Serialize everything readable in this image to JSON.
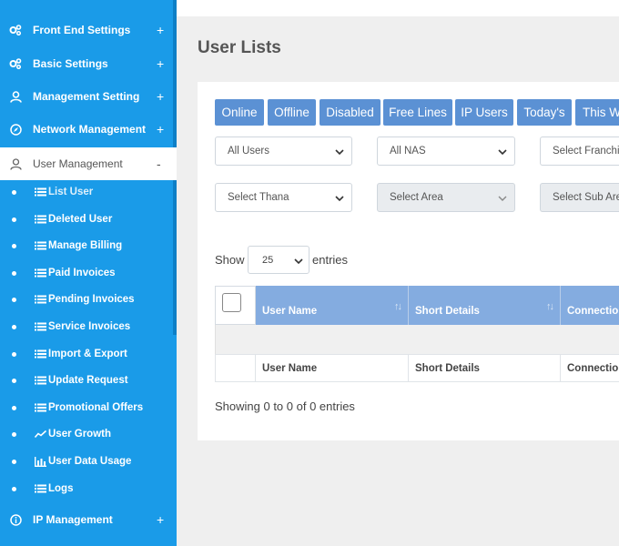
{
  "sidebar": {
    "menu": [
      {
        "label": "Front End Settings",
        "icon": "cogs-icon",
        "toggle": "+"
      },
      {
        "label": "Basic Settings",
        "icon": "cogs-icon",
        "toggle": "+"
      },
      {
        "label": "Management Setting",
        "icon": "user-icon",
        "toggle": "+"
      },
      {
        "label": "Network Management",
        "icon": "compass-icon",
        "toggle": "+"
      },
      {
        "label": "User Management",
        "icon": "user-icon",
        "toggle": "-"
      }
    ],
    "sub_items": [
      {
        "label": "List User",
        "icon": "list-icon"
      },
      {
        "label": "Deleted User",
        "icon": "list-icon"
      },
      {
        "label": "Manage Billing",
        "icon": "list-icon"
      },
      {
        "label": "Paid Invoices",
        "icon": "list-icon"
      },
      {
        "label": "Pending Invoices",
        "icon": "list-icon"
      },
      {
        "label": "Service Invoices",
        "icon": "list-icon"
      },
      {
        "label": "Import & Export",
        "icon": "list-icon"
      },
      {
        "label": "Update Request",
        "icon": "list-icon"
      },
      {
        "label": "Promotional Offers",
        "icon": "list-icon"
      },
      {
        "label": "User Growth",
        "icon": "line-chart-icon"
      },
      {
        "label": "User Data Usage",
        "icon": "bar-chart-icon"
      },
      {
        "label": "Logs",
        "icon": "list-icon"
      }
    ],
    "bottom_menu": {
      "label": "IP Management",
      "icon": "info-icon",
      "toggle": "+"
    }
  },
  "main": {
    "title": "User Lists",
    "filter_buttons": [
      "Online",
      "Offline",
      "Disabled",
      "Free Lines",
      "IP Users",
      "Today's",
      "This W"
    ],
    "selects": {
      "users": "All Users",
      "nas": "All NAS",
      "franchise": "Select Franchis",
      "thana": "Select Thana",
      "area": "Select Area",
      "sub_area": "Select Sub Are"
    },
    "length": {
      "show": "Show",
      "value": "25",
      "entries": "entries"
    },
    "table": {
      "headers": [
        "User Name",
        "Short Details",
        "Connection"
      ],
      "footers": [
        "User Name",
        "Short Details",
        "Connection"
      ]
    },
    "info": "Showing 0 to 0 of 0 entries"
  },
  "colors": {
    "sidebar": "#1a9be8",
    "button": "#5b91d4",
    "table_header": "#84ace0"
  }
}
